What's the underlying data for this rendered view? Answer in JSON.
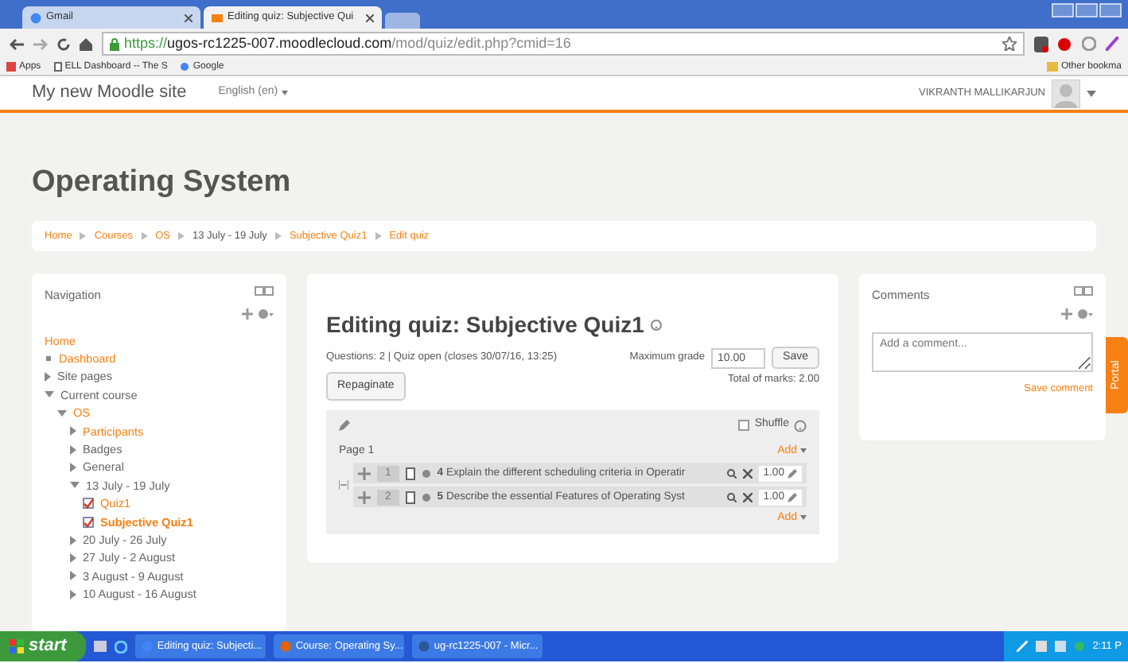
{
  "browser": {
    "tabs": [
      {
        "label": "Gmail",
        "selected": false
      },
      {
        "label": "Editing quiz: Subjective Qui",
        "selected": true
      }
    ],
    "url": {
      "scheme": "https://",
      "host": "ugos-rc1225-007.moodlecloud.com",
      "path": "/mod/quiz/edit.php?cmid=16"
    },
    "bookmarks": [
      "Apps",
      "ELL Dashboard -- The S",
      "Google"
    ],
    "other_bookmarks": "Other bookma"
  },
  "navbar": {
    "brand": "My new Moodle site",
    "language": "English (en)",
    "user": "VIKRANTH MALLIKARJUN"
  },
  "course_title": "Operating System",
  "breadcrumb": [
    {
      "label": "Home",
      "link": true
    },
    {
      "label": "Courses",
      "link": true
    },
    {
      "label": "OS",
      "link": true
    },
    {
      "label": "13 July - 19 July",
      "link": false
    },
    {
      "label": "Subjective Quiz1",
      "link": true
    },
    {
      "label": "Edit quiz",
      "link": true
    }
  ],
  "navigation": {
    "title": "Navigation",
    "items": [
      {
        "label": "Home",
        "kind": "root",
        "link": true
      },
      {
        "label": "Dashboard",
        "kind": "leaf",
        "link": true
      },
      {
        "label": "Site pages",
        "kind": "branch",
        "expanded": false,
        "link": false
      },
      {
        "label": "Current course",
        "kind": "branch",
        "expanded": true,
        "link": false,
        "children": [
          {
            "label": "OS",
            "kind": "branch",
            "expanded": true,
            "link": true,
            "children": [
              {
                "label": "Participants",
                "kind": "branch",
                "expanded": false,
                "link": true
              },
              {
                "label": "Badges",
                "kind": "branch",
                "expanded": false,
                "link": false
              },
              {
                "label": "General",
                "kind": "branch",
                "expanded": false,
                "link": false
              },
              {
                "label": "13 July - 19 July",
                "kind": "branch",
                "expanded": true,
                "link": false,
                "children": [
                  {
                    "label": "Quiz1",
                    "kind": "quiz",
                    "link": true,
                    "selected": false
                  },
                  {
                    "label": "Subjective Quiz1",
                    "kind": "quiz",
                    "link": true,
                    "selected": true
                  }
                ]
              },
              {
                "label": "20 July - 26 July",
                "kind": "branch",
                "expanded": false,
                "link": false
              },
              {
                "label": "27 July - 2 August",
                "kind": "branch",
                "expanded": false,
                "link": false
              },
              {
                "label": "3 August - 9 August",
                "kind": "branch",
                "expanded": false,
                "link": false
              },
              {
                "label": "10 August - 16 August",
                "kind": "branch",
                "expanded": false,
                "link": false
              }
            ]
          }
        ]
      }
    ]
  },
  "quiz": {
    "title": "Editing quiz: Subjective Quiz1",
    "status": "Questions: 2 | Quiz open (closes 30/07/16, 13:25)",
    "max_grade_label": "Maximum grade",
    "max_grade": "10.00",
    "save": "Save",
    "repaginate": "Repaginate",
    "total": "Total of marks: 2.00",
    "shuffle": {
      "label": "Shuffle",
      "checked": false
    },
    "page": "Page 1",
    "add": "Add",
    "questions": [
      {
        "number": "1",
        "text": "**4** Explain the different  scheduling criteria in Operatir",
        "mark": "1.00"
      },
      {
        "number": "2",
        "text": "**5** Describe the essential Features of Operating Syst",
        "mark": "1.00"
      }
    ],
    "add_bottom": "Add"
  },
  "comments": {
    "title": "Comments",
    "placeholder": "Add a comment...",
    "save": "Save comment"
  },
  "portal_tab": "Portal",
  "taskbar": {
    "start": "start",
    "tasks": [
      "Editing quiz: Subjecti...",
      "Course: Operating Sy...",
      "ug-rc1225-007 - Micr..."
    ],
    "clock": "2:11 P"
  }
}
